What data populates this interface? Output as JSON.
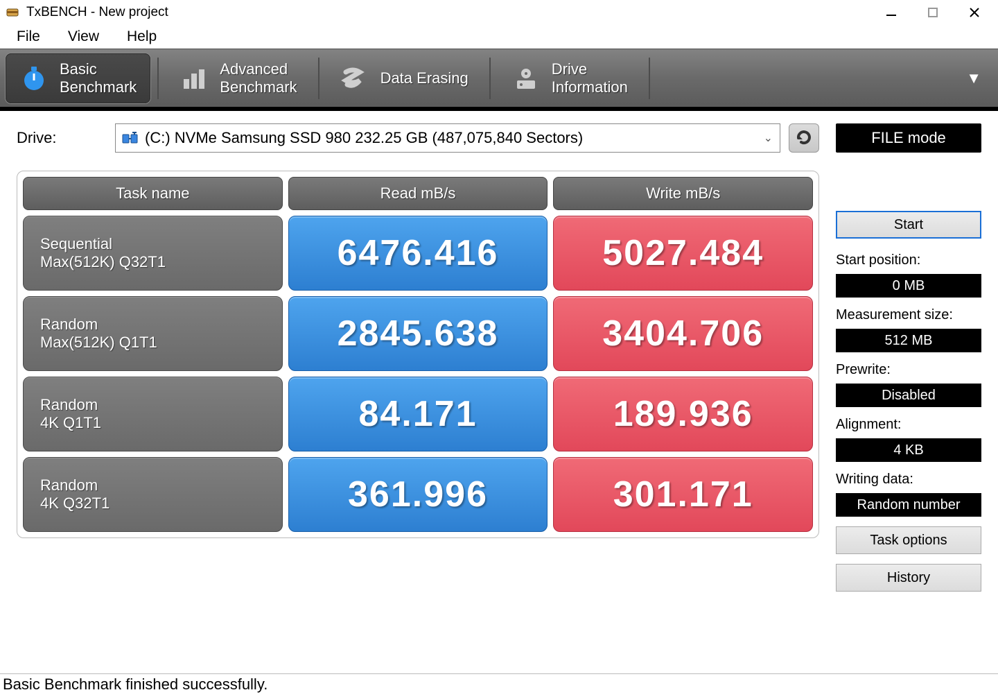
{
  "window": {
    "title": "TxBENCH - New project"
  },
  "menu": {
    "file": "File",
    "view": "View",
    "help": "Help"
  },
  "tabs": {
    "basic": {
      "line1": "Basic",
      "line2": "Benchmark"
    },
    "advanced": {
      "line1": "Advanced",
      "line2": "Benchmark"
    },
    "erase": {
      "line1": "Data Erasing"
    },
    "info": {
      "line1": "Drive",
      "line2": "Information"
    }
  },
  "drive": {
    "label": "Drive:",
    "value": "(C:) NVMe Samsung SSD 980  232.25 GB (487,075,840 Sectors)",
    "mode_button": "FILE mode"
  },
  "headers": {
    "task": "Task name",
    "read": "Read mB/s",
    "write": "Write mB/s"
  },
  "tasks": [
    {
      "line1": "Sequential",
      "line2": "Max(512K) Q32T1",
      "read": "6476.416",
      "write": "5027.484"
    },
    {
      "line1": "Random",
      "line2": "Max(512K) Q1T1",
      "read": "2845.638",
      "write": "3404.706"
    },
    {
      "line1": "Random",
      "line2": "4K Q1T1",
      "read": "84.171",
      "write": "189.936"
    },
    {
      "line1": "Random",
      "line2": "4K Q32T1",
      "read": "361.996",
      "write": "301.171"
    }
  ],
  "side": {
    "start": "Start",
    "start_pos_lbl": "Start position:",
    "start_pos_val": "0 MB",
    "meas_lbl": "Measurement size:",
    "meas_val": "512 MB",
    "prewrite_lbl": "Prewrite:",
    "prewrite_val": "Disabled",
    "align_lbl": "Alignment:",
    "align_val": "4 KB",
    "wdata_lbl": "Writing data:",
    "wdata_val": "Random number",
    "task_opt": "Task options",
    "history": "History"
  },
  "status": "Basic Benchmark finished successfully.",
  "chart_data": {
    "type": "table",
    "title": "TxBENCH Basic Benchmark - NVMe Samsung SSD 980 232.25 GB",
    "columns": [
      "Task name",
      "Read mB/s",
      "Write mB/s"
    ],
    "rows": [
      [
        "Sequential Max(512K) Q32T1",
        6476.416,
        5027.484
      ],
      [
        "Random Max(512K) Q1T1",
        2845.638,
        3404.706
      ],
      [
        "Random 4K Q1T1",
        84.171,
        189.936
      ],
      [
        "Random 4K Q32T1",
        361.996,
        301.171
      ]
    ]
  }
}
